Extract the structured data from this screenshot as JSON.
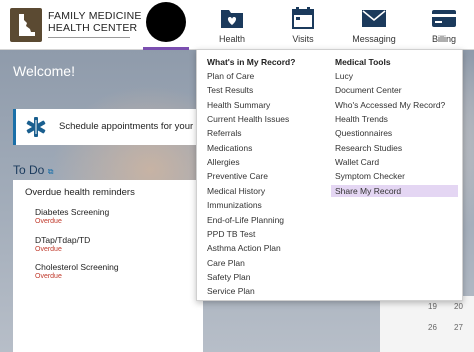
{
  "brand": {
    "line1": "FAMILY MEDICINE",
    "line2": "HEALTH CENTER"
  },
  "nav": [
    {
      "label": "Health",
      "icon": "health-folder-icon"
    },
    {
      "label": "Visits",
      "icon": "calendar-icon"
    },
    {
      "label": "Messaging",
      "icon": "envelope-icon"
    },
    {
      "label": "Billing",
      "icon": "credit-card-icon"
    }
  ],
  "welcome": "Welcome!",
  "appointment_text": "Schedule appointments for your c",
  "todo": {
    "title": "To Do",
    "heading": "Overdue health reminders",
    "items": [
      {
        "name": "Diabetes Screening",
        "status": "Overdue"
      },
      {
        "name": "DTap/Tdap/TD",
        "status": "Overdue"
      },
      {
        "name": "Cholesterol Screening",
        "status": "Overdue"
      }
    ]
  },
  "calendar_days": [
    "19",
    "20",
    "26",
    "27"
  ],
  "dropdown": {
    "left_heading": "What's in My Record?",
    "left_items": [
      "Plan of Care",
      "Test Results",
      "Health Summary",
      "Current Health Issues",
      "Referrals",
      "Medications",
      "Allergies",
      "Preventive Care",
      "Medical History",
      "Immunizations",
      "End-of-Life Planning",
      "PPD TB Test",
      "Asthma Action Plan",
      "Care Plan",
      "Safety Plan",
      "Service Plan"
    ],
    "right_heading": "Medical Tools",
    "right_items": [
      "Lucy",
      "Document Center",
      "Who's Accessed My Record?",
      "Health Trends",
      "Questionnaires",
      "Research Studies",
      "Wallet Card",
      "Symptom Checker",
      "Share My Record"
    ],
    "highlighted_item": "Share My Record"
  },
  "colors": {
    "accent_purple": "#7b4fb0",
    "highlight": "#e4d6f3",
    "link_blue": "#1a6fa8",
    "overdue_red": "#c0392b",
    "logo_brown": "#5b4a32"
  }
}
